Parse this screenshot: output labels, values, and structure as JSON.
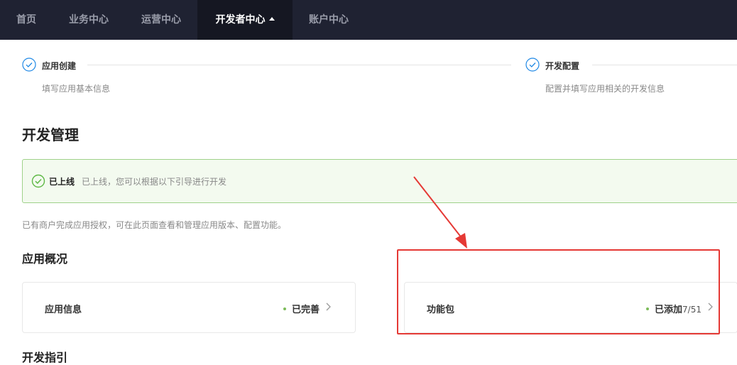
{
  "nav": {
    "items": [
      {
        "label": "首页"
      },
      {
        "label": "业务中心"
      },
      {
        "label": "运营中心"
      },
      {
        "label": "开发者中心"
      },
      {
        "label": "账户中心"
      }
    ],
    "active_index": 3
  },
  "steps": [
    {
      "title": "应用创建",
      "desc": "填写应用基本信息"
    },
    {
      "title": "开发配置",
      "desc": "配置并填写应用相关的开发信息"
    }
  ],
  "page_title": "开发管理",
  "alert": {
    "title": "已上线",
    "text": "已上线，您可以根据以下引导进行开发"
  },
  "description": "已有商户完成应用授权，可在此页面查看和管理应用版本、配置功能。",
  "section_title": "应用概况",
  "cards": [
    {
      "label": "应用信息",
      "status": "已完善",
      "count": ""
    },
    {
      "label": "功能包",
      "status": "已添加",
      "count": "7/51"
    }
  ],
  "next_section_title": "开发指引",
  "colors": {
    "nav_bg": "#1f2232",
    "nav_active_bg": "#151722",
    "accent": "#1e88e5",
    "success": "#5fb947",
    "annotation_red": "#e53935"
  }
}
